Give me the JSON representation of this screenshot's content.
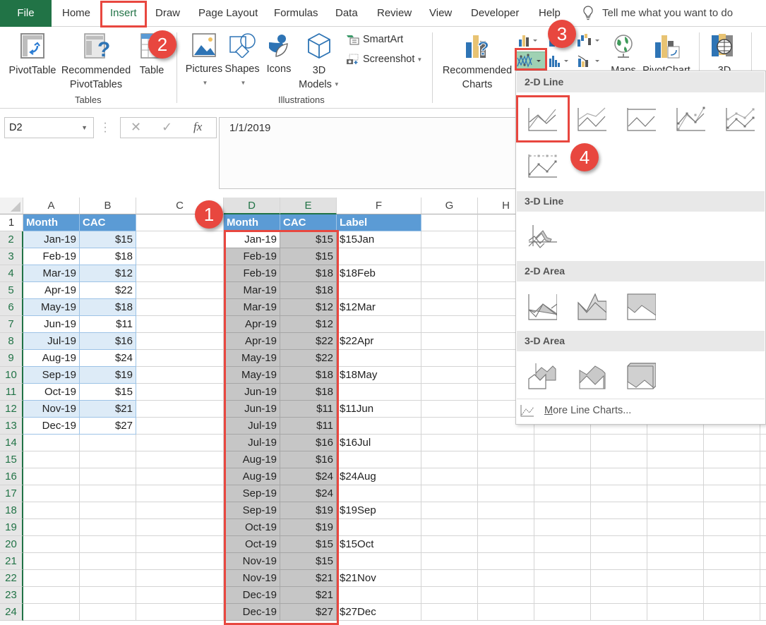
{
  "ribbon_tabs": [
    {
      "id": "file",
      "label": "File"
    },
    {
      "id": "home",
      "label": "Home"
    },
    {
      "id": "insert",
      "label": "Insert",
      "active": true
    },
    {
      "id": "draw",
      "label": "Draw"
    },
    {
      "id": "page_layout",
      "label": "Page Layout"
    },
    {
      "id": "formulas",
      "label": "Formulas"
    },
    {
      "id": "data",
      "label": "Data"
    },
    {
      "id": "review",
      "label": "Review"
    },
    {
      "id": "view",
      "label": "View"
    },
    {
      "id": "developer",
      "label": "Developer"
    },
    {
      "id": "help",
      "label": "Help"
    }
  ],
  "tell_me": "Tell me what you want to do",
  "ribbon": {
    "tables": {
      "label": "Tables",
      "pivot_table": "PivotTable",
      "recommended_pivot_1": "Recommended",
      "recommended_pivot_2": "PivotTables",
      "table": "Table"
    },
    "illustrations": {
      "label": "Illustrations",
      "pictures": "Pictures",
      "shapes": "Shapes",
      "icons": "Icons",
      "models_1": "3D",
      "models_2": "Models",
      "smartart": "SmartArt",
      "screenshot": "Screenshot"
    },
    "charts": {
      "recommended_1": "Recommended",
      "recommended_2": "Charts",
      "maps": "Maps",
      "pivotchart": "PivotChart",
      "map3d": "3D"
    }
  },
  "formula_bar": {
    "name_box": "D2",
    "fx": "fx",
    "value": "1/1/2019"
  },
  "columns": [
    "A",
    "B",
    "C",
    "D",
    "E",
    "F",
    "G",
    "H"
  ],
  "rows": [
    "1",
    "2",
    "3",
    "4",
    "5",
    "6",
    "7",
    "8",
    "9",
    "10",
    "11",
    "12",
    "13",
    "14",
    "15",
    "16",
    "17",
    "18",
    "19",
    "20",
    "21",
    "22",
    "23",
    "24"
  ],
  "table1": {
    "headers": [
      "Month",
      "CAC"
    ],
    "rows": [
      [
        "Jan-19",
        "$15"
      ],
      [
        "Feb-19",
        "$18"
      ],
      [
        "Mar-19",
        "$12"
      ],
      [
        "Apr-19",
        "$22"
      ],
      [
        "May-19",
        "$18"
      ],
      [
        "Jun-19",
        "$11"
      ],
      [
        "Jul-19",
        "$16"
      ],
      [
        "Aug-19",
        "$24"
      ],
      [
        "Sep-19",
        "$19"
      ],
      [
        "Oct-19",
        "$15"
      ],
      [
        "Nov-19",
        "$21"
      ],
      [
        "Dec-19",
        "$27"
      ]
    ]
  },
  "table2": {
    "headers": [
      "Month",
      "CAC",
      "Label"
    ],
    "rows": [
      [
        "Jan-19",
        "$15",
        "$15Jan"
      ],
      [
        "Feb-19",
        "$15",
        ""
      ],
      [
        "Feb-19",
        "$18",
        "$18Feb"
      ],
      [
        "Mar-19",
        "$18",
        ""
      ],
      [
        "Mar-19",
        "$12",
        "$12Mar"
      ],
      [
        "Apr-19",
        "$12",
        ""
      ],
      [
        "Apr-19",
        "$22",
        "$22Apr"
      ],
      [
        "May-19",
        "$22",
        ""
      ],
      [
        "May-19",
        "$18",
        "$18May"
      ],
      [
        "Jun-19",
        "$18",
        ""
      ],
      [
        "Jun-19",
        "$11",
        "$11Jun"
      ],
      [
        "Jul-19",
        "$11",
        ""
      ],
      [
        "Jul-19",
        "$16",
        "$16Jul"
      ],
      [
        "Aug-19",
        "$16",
        ""
      ],
      [
        "Aug-19",
        "$24",
        "$24Aug"
      ],
      [
        "Sep-19",
        "$24",
        ""
      ],
      [
        "Sep-19",
        "$19",
        "$19Sep"
      ],
      [
        "Oct-19",
        "$19",
        ""
      ],
      [
        "Oct-19",
        "$15",
        "$15Oct"
      ],
      [
        "Nov-19",
        "$15",
        ""
      ],
      [
        "Nov-19",
        "$21",
        "$21Nov"
      ],
      [
        "Dec-19",
        "$21",
        ""
      ],
      [
        "Dec-19",
        "$27",
        "$27Dec"
      ]
    ]
  },
  "gallery": {
    "sections": [
      {
        "title": "2-D Line",
        "items": [
          "Line",
          "Stacked Line",
          "100% Stacked Line",
          "Line with Markers",
          "Stacked Line with Markers",
          "100% Stacked Line with Markers"
        ]
      },
      {
        "title": "3-D Line",
        "items": [
          "3-D Line"
        ]
      },
      {
        "title": "2-D Area",
        "items": [
          "Area",
          "Stacked Area",
          "100% Stacked Area"
        ]
      },
      {
        "title": "3-D Area",
        "items": [
          "3-D Area",
          "3-D Stacked Area",
          "3-D 100% Stacked Area"
        ]
      }
    ],
    "more_prefix": "M",
    "more_rest": "ore Line Charts..."
  },
  "callouts": [
    "1",
    "2",
    "3",
    "4"
  ],
  "colors": {
    "excel_green": "#217346",
    "table_header": "#5b9bd5",
    "table_band": "#ddebf7",
    "selection_gray": "#c6c6c6",
    "callout_red": "#e8473f"
  }
}
